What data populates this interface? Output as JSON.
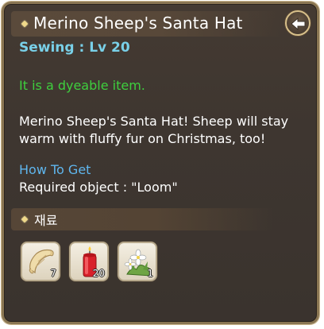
{
  "item": {
    "title": "Merino Sheep's Santa Hat",
    "skill_requirement": "Sewing : Lv 20",
    "dyeable_note": "It is a dyeable item.",
    "description": "Merino Sheep's Santa Hat! Sheep will stay warm with fluffy fur on Christmas, too!",
    "how_to_get_heading": "How To Get",
    "required_object": "Required object : \"Loom\""
  },
  "materials": {
    "heading": "재료",
    "slots": [
      {
        "icon": "scroll-icon",
        "quantity": "7"
      },
      {
        "icon": "red-candle-icon",
        "quantity": "20"
      },
      {
        "icon": "white-flower-icon",
        "quantity": "1"
      }
    ]
  },
  "colors": {
    "skill": "#79d0e8",
    "dyeable": "#3ecf3e",
    "how_to_get": "#5fb6ee",
    "panel_border": "#8a7653"
  }
}
